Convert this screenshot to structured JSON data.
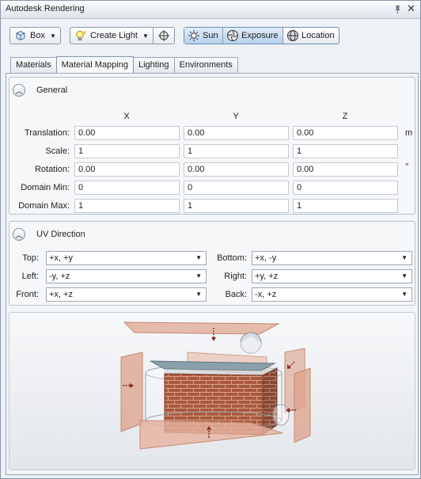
{
  "window": {
    "title": "Autodesk Rendering"
  },
  "toolbar": {
    "box_label": "Box",
    "create_light_label": "Create Light",
    "sun_label": "Sun",
    "exposure_label": "Exposure",
    "location_label": "Location"
  },
  "tabs": [
    {
      "label": "Materials"
    },
    {
      "label": "Material Mapping"
    },
    {
      "label": "Lighting"
    },
    {
      "label": "Environments"
    }
  ],
  "general": {
    "title": "General",
    "columns": [
      "X",
      "Y",
      "Z"
    ],
    "rows": [
      {
        "label": "Translation:",
        "x": "0.00",
        "y": "0.00",
        "z": "0.00",
        "unit": "m"
      },
      {
        "label": "Scale:",
        "x": "1",
        "y": "1",
        "z": "1",
        "unit": ""
      },
      {
        "label": "Rotation:",
        "x": "0.00",
        "y": "0.00",
        "z": "0.00",
        "unit": "°"
      },
      {
        "label": "Domain Min:",
        "x": "0",
        "y": "0",
        "z": "0",
        "unit": ""
      },
      {
        "label": "Domain Max:",
        "x": "1",
        "y": "1",
        "z": "1",
        "unit": ""
      }
    ]
  },
  "uv": {
    "title": "UV Direction",
    "top_label": "Top:",
    "top_value": "+x, +y",
    "bottom_label": "Bottom:",
    "bottom_value": "+x, -y",
    "left_label": "Left:",
    "left_value": "-y, +z",
    "right_label": "Right:",
    "right_value": "+y, +z",
    "front_label": "Front:",
    "front_value": "+x, +z",
    "back_label": "Back:",
    "back_value": "-x, +z"
  },
  "colors": {
    "accent": "#b9d4ef",
    "panel": "#eef1f5",
    "brick": "#a9583d"
  }
}
